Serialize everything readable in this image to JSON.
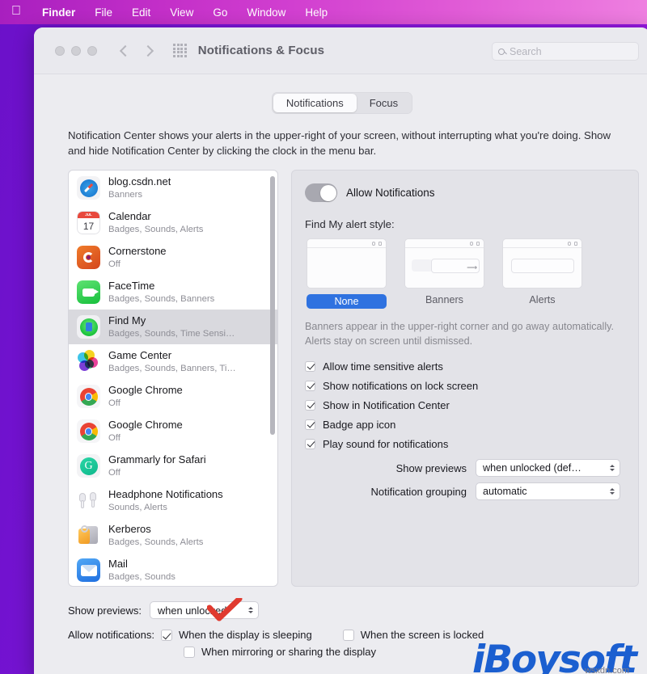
{
  "menubar": {
    "apple_icon": "apple-logo-icon",
    "items": [
      {
        "label": "Finder",
        "bold": true
      },
      {
        "label": "File",
        "bold": false
      },
      {
        "label": "Edit",
        "bold": false
      },
      {
        "label": "View",
        "bold": false
      },
      {
        "label": "Go",
        "bold": false
      },
      {
        "label": "Window",
        "bold": false
      },
      {
        "label": "Help",
        "bold": false
      }
    ]
  },
  "window": {
    "title": "Notifications & Focus",
    "search_placeholder": "Search",
    "traffic_lights": [
      "close",
      "minimize",
      "zoom"
    ]
  },
  "tabs": [
    {
      "label": "Notifications",
      "active": true
    },
    {
      "label": "Focus",
      "active": false
    }
  ],
  "description": "Notification Center shows your alerts in the upper-right of your screen, without interrupting what you're doing. Show and hide Notification Center by clicking the clock in the menu bar.",
  "app_list": [
    {
      "name": "blog.csdn.net",
      "sub": "Banners",
      "selected": false,
      "icon": "safari-icon"
    },
    {
      "name": "Calendar",
      "sub": "Badges, Sounds, Alerts",
      "selected": false,
      "icon": "calendar-icon"
    },
    {
      "name": "Cornerstone",
      "sub": "Off",
      "selected": false,
      "icon": "cornerstone-icon"
    },
    {
      "name": "FaceTime",
      "sub": "Badges, Sounds, Banners",
      "selected": false,
      "icon": "facetime-icon"
    },
    {
      "name": "Find My",
      "sub": "Badges, Sounds, Time Sensi…",
      "selected": true,
      "icon": "findmy-icon"
    },
    {
      "name": "Game Center",
      "sub": "Badges, Sounds, Banners, Ti…",
      "selected": false,
      "icon": "gamecenter-icon"
    },
    {
      "name": "Google Chrome",
      "sub": "Off",
      "selected": false,
      "icon": "chrome-icon"
    },
    {
      "name": "Google Chrome",
      "sub": "Off",
      "selected": false,
      "icon": "chrome-icon"
    },
    {
      "name": "Grammarly for Safari",
      "sub": "Off",
      "selected": false,
      "icon": "grammarly-icon"
    },
    {
      "name": "Headphone Notifications",
      "sub": "Sounds, Alerts",
      "selected": false,
      "icon": "airpods-icon"
    },
    {
      "name": "Kerberos",
      "sub": "Badges, Sounds, Alerts",
      "selected": false,
      "icon": "kerberos-icon"
    },
    {
      "name": "Mail",
      "sub": "Badges, Sounds",
      "selected": false,
      "icon": "mail-icon"
    }
  ],
  "detail": {
    "allow_notifications_label": "Allow Notifications",
    "allow_notifications_on": true,
    "alert_style_label": "Find My alert style:",
    "alert_styles": [
      {
        "label": "None",
        "selected": true
      },
      {
        "label": "Banners",
        "selected": false
      },
      {
        "label": "Alerts",
        "selected": false
      }
    ],
    "banner_description": "Banners appear in the upper-right corner and go away automatically. Alerts stay on screen until dismissed.",
    "checkboxes": [
      {
        "label": "Allow time sensitive alerts",
        "checked": true
      },
      {
        "label": "Show notifications on lock screen",
        "checked": true
      },
      {
        "label": "Show in Notification Center",
        "checked": true
      },
      {
        "label": "Badge app icon",
        "checked": true
      },
      {
        "label": "Play sound for notifications",
        "checked": true
      }
    ],
    "show_previews_label": "Show previews",
    "show_previews_value": "when unlocked (def…",
    "notification_grouping_label": "Notification grouping",
    "notification_grouping_value": "automatic"
  },
  "bottom": {
    "show_previews_label": "Show previews:",
    "show_previews_value": "when unlocked",
    "allow_notifications_label": "Allow notifications:",
    "options": [
      {
        "label": "When the display is sleeping",
        "checked": true
      },
      {
        "label": "When the screen is locked",
        "checked": false
      },
      {
        "label": "When mirroring or sharing the display",
        "checked": false
      }
    ]
  },
  "watermark": {
    "brand": "iBoysoft",
    "site": "wsxdn.com",
    "brand_color": "#1b5fd0"
  },
  "colors": {
    "accent_blue": "#2f72e0",
    "desktop_purple": "#7a14d6",
    "menubar_pink": "#d13fd0",
    "annotation_red": "#e03a2f"
  }
}
